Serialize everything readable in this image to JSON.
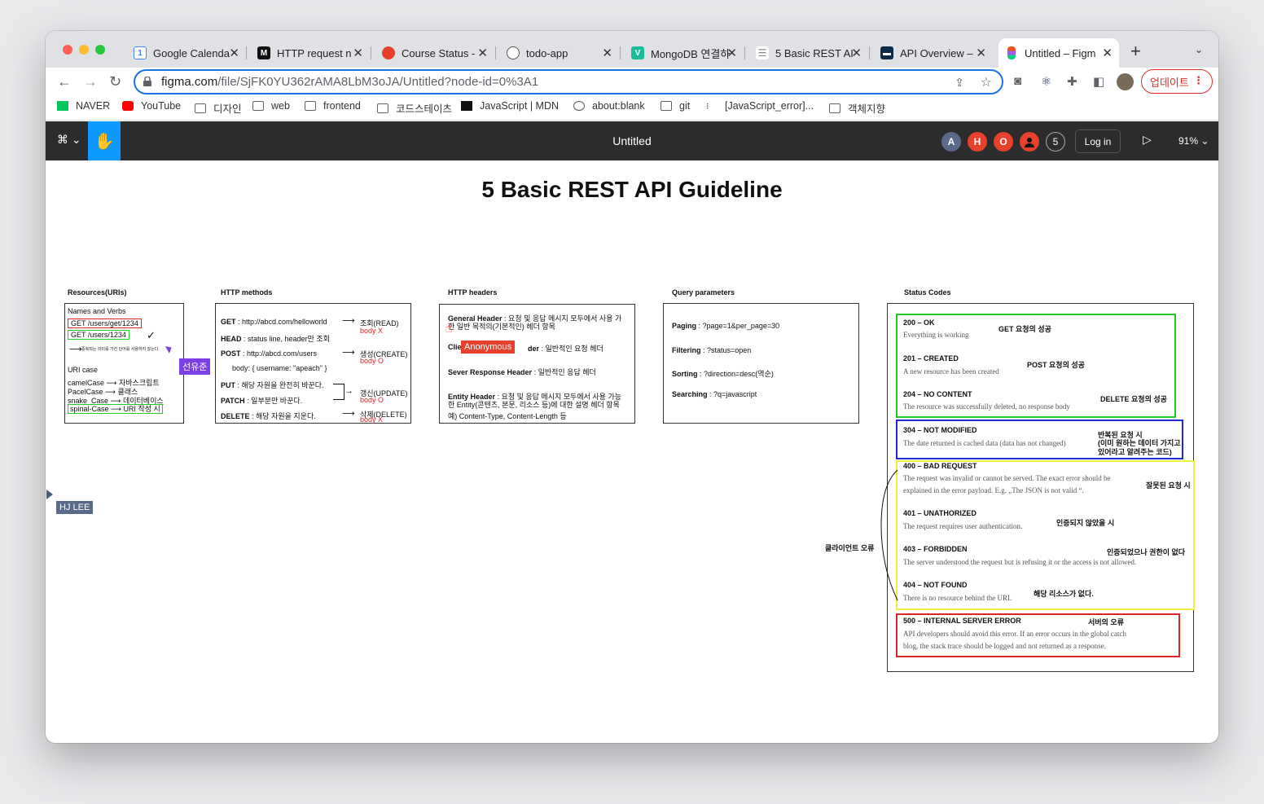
{
  "browser": {
    "tabs": [
      {
        "title": "Google Calenda",
        "icon": "calendar-icon"
      },
      {
        "title": "HTTP request n",
        "icon": "mdn-icon"
      },
      {
        "title": "Course Status -",
        "icon": "apple-icon"
      },
      {
        "title": "todo-app",
        "icon": "globe-icon"
      },
      {
        "title": "MongoDB 연결하",
        "icon": "v-icon"
      },
      {
        "title": "5 Basic REST AI",
        "icon": "list-icon"
      },
      {
        "title": "API Overview –",
        "icon": "api-icon"
      },
      {
        "title": "Untitled – Figm",
        "icon": "figma-icon"
      }
    ],
    "url_host": "figma.com",
    "url_path": "/file/SjFK0YU362rAMA8LbM3oJA/Untitled?node-id=0%3A1",
    "update_label": "업데이트",
    "bookmarks": [
      "NAVER",
      "YouTube",
      "디자인",
      "web",
      "frontend",
      "코드스테이츠",
      "JavaScript | MDN",
      "about:blank",
      "git",
      "[JavaScript_error]...",
      "객체지향"
    ]
  },
  "figma": {
    "doc_title": "Untitled",
    "avatars": [
      "A",
      "H",
      "O",
      "",
      "5"
    ],
    "login_label": "Log in",
    "zoom": "91%"
  },
  "board": {
    "title": "5 Basic REST API Guideline",
    "resources": {
      "label": "Resources(URIs)",
      "heading": "Names and Verbs",
      "bad": "GET /users/get/1234",
      "good": "GET /users/1234",
      "note": "중복되는 의미를 가진 단어를 사용하지 않는다.",
      "case_heading": "URI case",
      "cases": [
        {
          "name": "camelCase",
          "desc": "자바스크립트"
        },
        {
          "name": "PacelCase",
          "desc": "클래스"
        },
        {
          "name": "snake_Case",
          "desc": "데이터베이스"
        },
        {
          "name": "spinal-Case",
          "desc": "URI 작성 시"
        }
      ]
    },
    "methods": {
      "label": "HTTP methods",
      "get": {
        "name": "GET",
        "text": " : http://abcd.com/helloworld",
        "note": "조회(READ)",
        "body": "body X"
      },
      "head": {
        "name": "HEAD",
        "text": " : status line, header만 조회"
      },
      "post": {
        "name": "POST",
        "text": " : http://abcd.com/users",
        "note": "생성(CREATE)",
        "body": "body O",
        "body_example": "body: { username: \"apeach\" }"
      },
      "put": {
        "name": "PUT",
        "text": " : 해당 자원을 완전히 바꾼다."
      },
      "patch": {
        "name": "PATCH",
        "text": " : 일부분만 바꾼다.",
        "note": "갱신(UPDATE)",
        "body": "body O"
      },
      "delete": {
        "name": "DELETE",
        "text": " : 해당 자원을 지운다.",
        "note": "삭제(DELETE)",
        "body": "body X"
      }
    },
    "headers": {
      "label": "HTTP headers",
      "general": {
        "name": "General Header",
        "text": " : 요청 및 응답 메시지 모두에서 사용 가",
        "text2": "한 일반 목적의(기본적인) 헤더 항목"
      },
      "client": {
        "name": "Clie",
        "name_end": "der",
        "text": " : 일반적인 요청 헤더"
      },
      "server": {
        "name": "Sever Response Header",
        "text": " : 일반적인 응답 헤더"
      },
      "entity": {
        "name": "Entity Header",
        "text": " : 요청 및 응답 메시지 모두에서 사용 가능",
        "text2": "한 Entity(콘텐츠, 본문, 리소스 등)에 대한 설명 헤더 항목",
        "text3": "예) Content-Type, Content-Length 등"
      }
    },
    "query": {
      "label": "Query parameters",
      "items": [
        {
          "name": "Paging",
          "text": " : ?page=1&per_page=30"
        },
        {
          "name": "Filtering",
          "text": " : ?status=open"
        },
        {
          "name": "Sorting",
          "text": " : ?direction=desc(역순)"
        },
        {
          "name": "Searching",
          "text": " : ?q=javascript"
        }
      ]
    },
    "status": {
      "label": "Status Codes",
      "client_error_label": "클라이언트 오류",
      "codes": [
        {
          "code": "200 – OK",
          "desc": "Everything is working",
          "note": "GET 요청의 성공"
        },
        {
          "code": "201 – CREATED",
          "desc": "A new resource has been created",
          "note": "POST 요청의 성공"
        },
        {
          "code": "204 – NO CONTENT",
          "desc": "The resource was successfully deleted, no response body",
          "note": "DELETE 요청의 성공"
        },
        {
          "code": "304 – NOT MODIFIED",
          "desc": "The date returned is cached data (data has not changed)",
          "note": "반복된 요청 시",
          "note2": "(이미 원하는 데이터 가지고",
          "note3": "있어라고 알려주는 코드)"
        },
        {
          "code": "400 – BAD REQUEST",
          "desc": "The request was invalid or cannot be served. The exact error should be",
          "desc2": "explained in the error payload. E.g. „The JSON is not valid “.",
          "note": "잘못된 요청 시"
        },
        {
          "code": "401 – UNATHORIZED",
          "desc": "The request requires user authentication.",
          "note": "인증되지 않았을 시"
        },
        {
          "code": "403 – FORBIDDEN",
          "desc": "The server understood the request but is refusing it or the access is not allowed.",
          "note": "인증되었으나 권한이 없다"
        },
        {
          "code": "404 – NOT FOUND",
          "desc": "There is no resource behind the URI.",
          "note": "해당 리소스가 없다."
        },
        {
          "code": "500 – INTERNAL SERVER ERROR",
          "desc": "API developers should avoid this error. If an error occurs in the global catch",
          "desc2": "blog, the stack trace should be logged and not returned as a response.",
          "note": "서버의 오류"
        }
      ]
    },
    "cursors": {
      "anonymous": "Anonymous",
      "user1": "선유준",
      "user2": "HJ LEE"
    }
  },
  "colors": {
    "green": "#22cc22",
    "blue": "#1f2bd6",
    "yellow": "#eeee44",
    "red": "#e02424",
    "figma_blue": "#0d99ff"
  }
}
